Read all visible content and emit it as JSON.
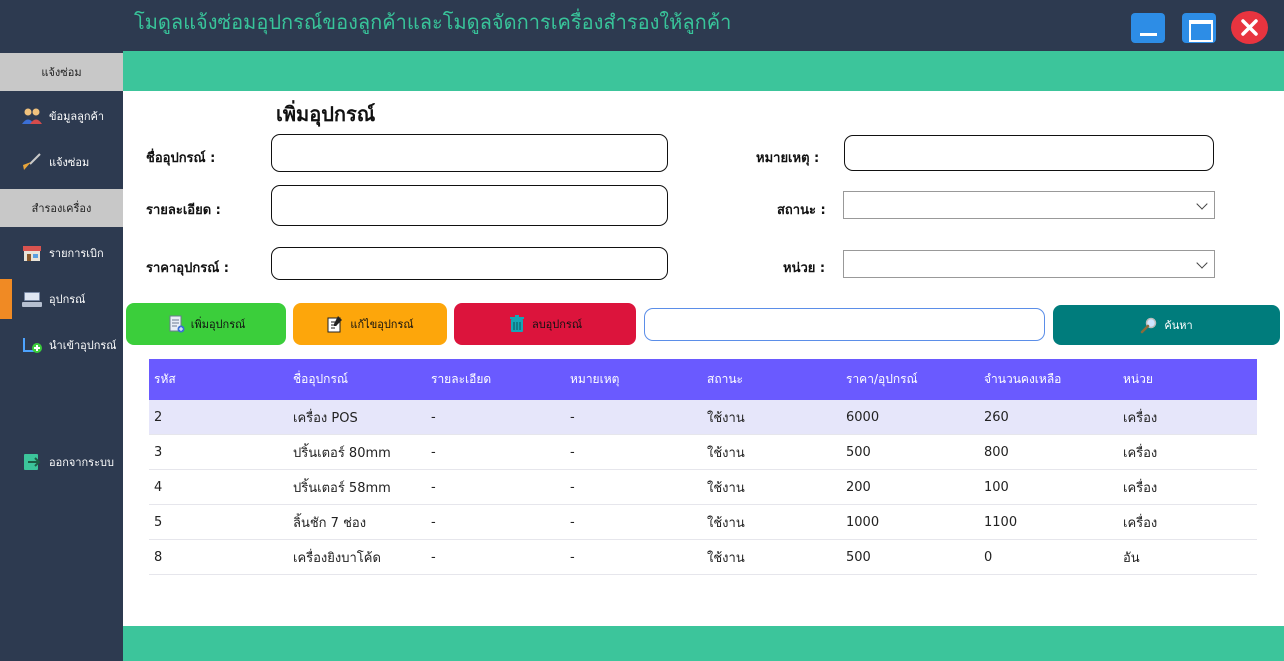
{
  "window": {
    "title": "โมดูลแจ้งซ่อมอุปกรณ์ของลูกค้าและโมดูลจัดการเครื่องสำรองให้ลูกค้า"
  },
  "sidebar": {
    "section_repair": "แจ้งซ่อม",
    "item_customer": "ข้อมูลลูกค้า",
    "item_repair": "แจ้งซ่อม",
    "section_backup": "สำรองเครื่อง",
    "item_withdraw": "รายการเบิก",
    "item_device": "อุปกรณ์",
    "item_import": "นำเข้าอุปกรณ์",
    "item_logout": "ออกจากระบบ"
  },
  "form": {
    "title": "เพิ่มอุปกรณ์",
    "name_label": "ชื่ออุปกรณ์ :",
    "detail_label": "รายละเอียด :",
    "price_label": "ราคาอุปกรณ์ :",
    "note_label": "หมายเหตุ :",
    "status_label": "สถานะ :",
    "unit_label": "หน่วย :",
    "name_value": "",
    "detail_value": "",
    "price_value": "",
    "note_value": "",
    "status_value": "",
    "unit_value": ""
  },
  "actions": {
    "add_label": "เพิ่มอุปกรณ์",
    "edit_label": "แก้ไขอุปกรณ์",
    "delete_label": "ลบอุปกรณ์",
    "search_value": "",
    "search_label": "ค้นหา"
  },
  "table": {
    "columns": [
      "รหัส",
      "ชื่ออุปกรณ์",
      "รายละเอียด",
      "หมายเหตุ",
      "สถานะ",
      "ราคา/อุปกรณ์",
      "จำนวนคงเหลือ",
      "หน่วย"
    ],
    "rows": [
      [
        "2",
        "เครื่อง POS",
        "-",
        "-",
        "ใช้งาน",
        "6000",
        "260",
        "เครื่อง"
      ],
      [
        "3",
        "ปริ้นเตอร์ 80mm",
        "-",
        "-",
        "ใช้งาน",
        "500",
        "800",
        "เครื่อง"
      ],
      [
        "4",
        "ปริ้นเตอร์ 58mm",
        "-",
        "-",
        "ใช้งาน",
        "200",
        "100",
        "เครื่อง"
      ],
      [
        "5",
        "ลิ้นชัก 7 ช่อง",
        "-",
        "-",
        "ใช้งาน",
        "1000",
        "1100",
        "เครื่อง"
      ],
      [
        "8",
        "เครื่องยิงบาโค้ด",
        "-",
        "-",
        "ใช้งาน",
        "500",
        "0",
        "อัน"
      ]
    ]
  },
  "colors": {
    "titlebar": "#2d3a50",
    "accent_green": "#3cc59b",
    "table_header": "#6a5aff",
    "selected_row": "#e6e6fa",
    "add_button": "#3bce3b",
    "edit_button": "#fda60b",
    "delete_button": "#dc143c",
    "search_button": "#007c7c"
  }
}
